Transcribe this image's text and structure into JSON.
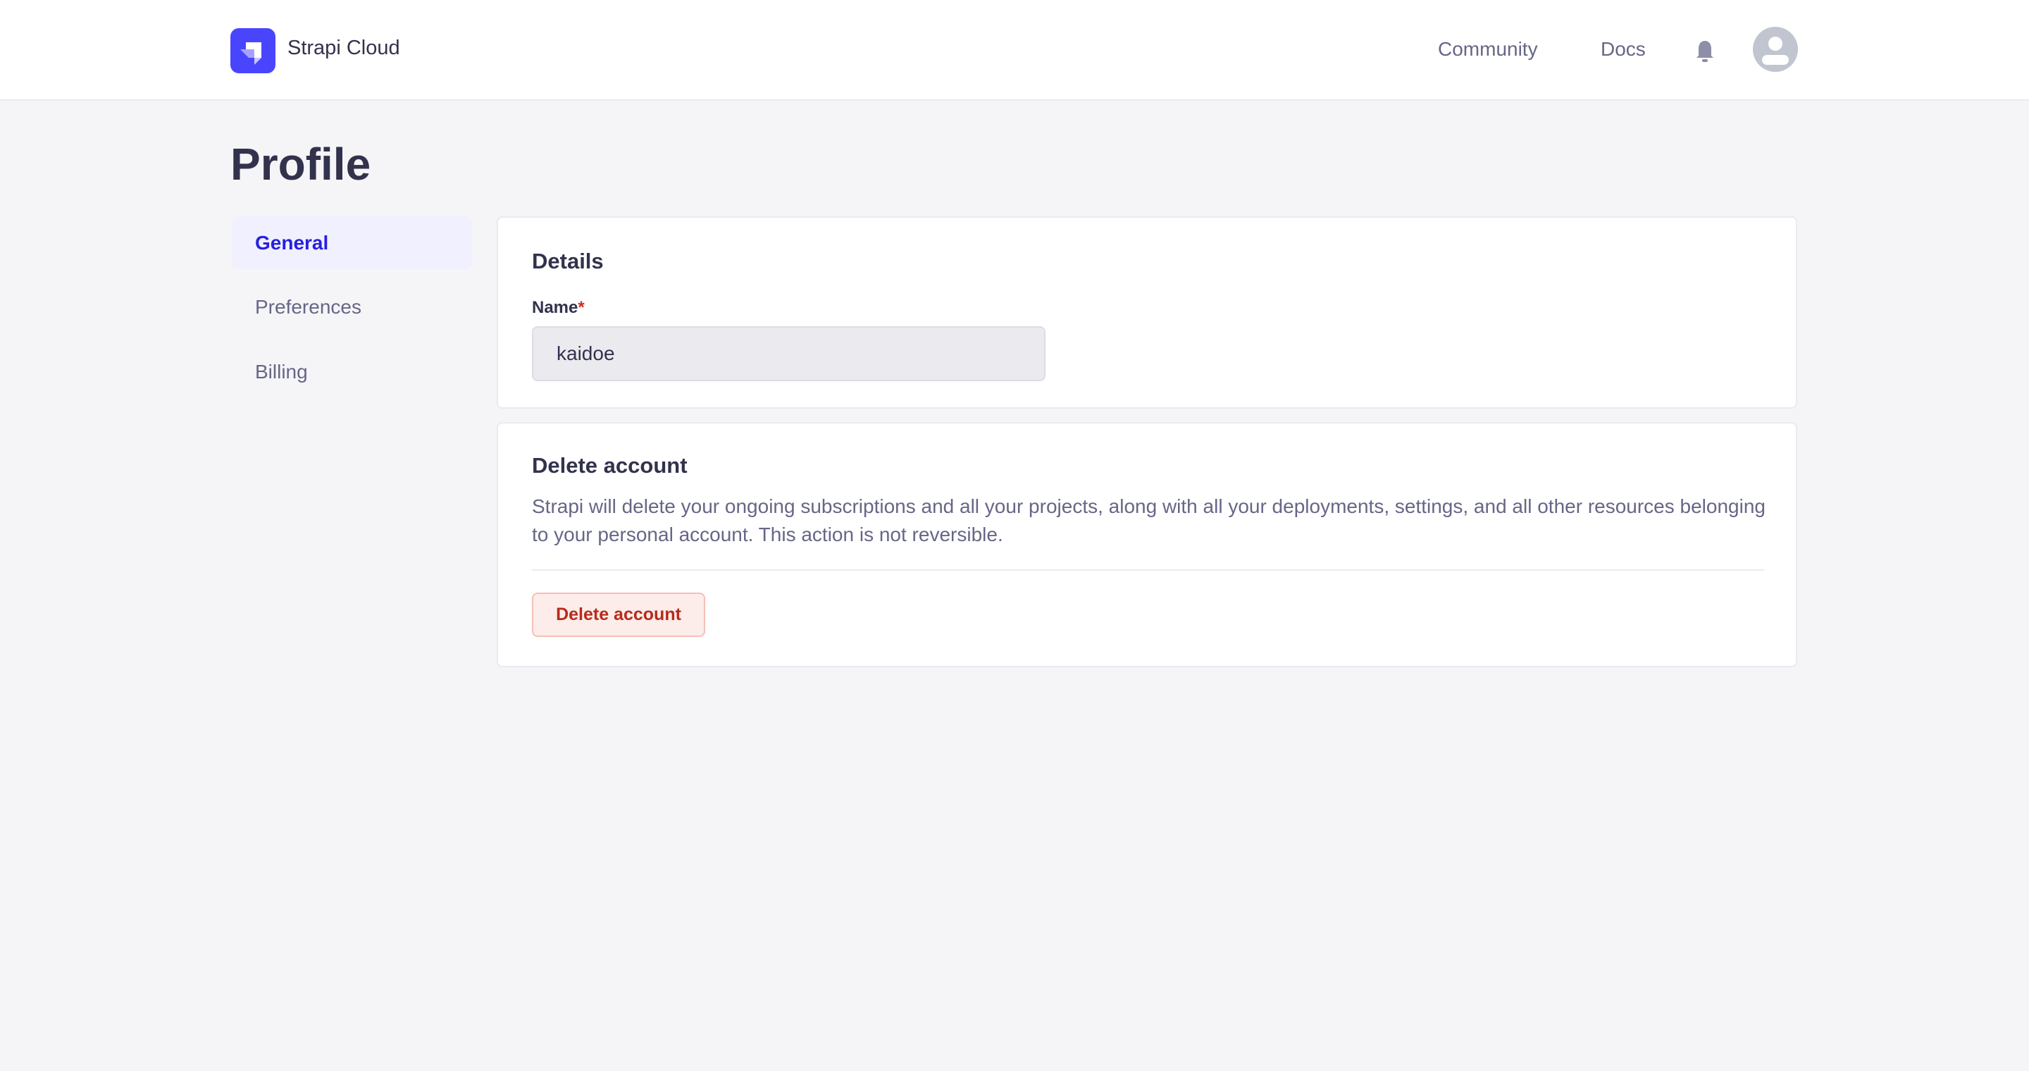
{
  "header": {
    "brand": "Strapi Cloud",
    "links": [
      "Community",
      "Docs"
    ]
  },
  "page": {
    "title": "Profile"
  },
  "sidebar": {
    "items": [
      {
        "label": "General",
        "active": true
      },
      {
        "label": "Preferences"
      },
      {
        "label": "Billing"
      }
    ]
  },
  "details": {
    "title": "Details",
    "name_label": "Name",
    "required_mark": "*",
    "name_value": "kaidoe"
  },
  "delete": {
    "title": "Delete account",
    "description": "Strapi will delete your ongoing subscriptions and all your projects, along with all your deployments, settings, and all other resources belonging to your personal account. This action is not reversible.",
    "button_label": "Delete account"
  },
  "colors": {
    "brand": "#4945ff",
    "danger": "#d02b20"
  }
}
